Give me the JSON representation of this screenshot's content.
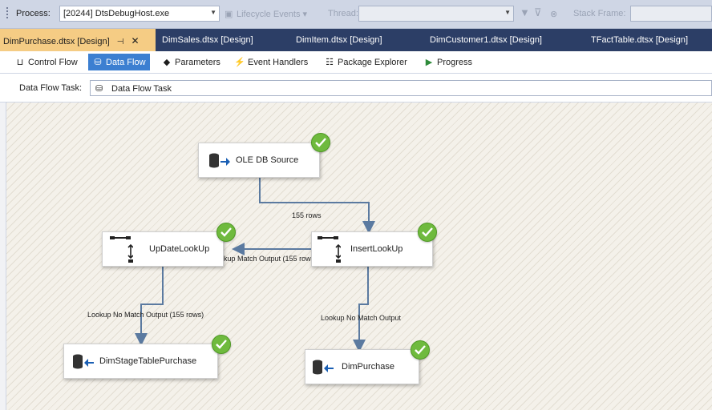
{
  "debug_toolbar": {
    "process_label": "Process:",
    "process_value": "[20244] DtsDebugHost.exe",
    "lifecycle_label": "Lifecycle Events",
    "thread_label": "Thread:",
    "stack_frame_label": "Stack Frame:"
  },
  "document_tabs": [
    {
      "label": "DimPurchase.dtsx [Design]",
      "active": true
    },
    {
      "label": "DimSales.dtsx [Design]"
    },
    {
      "label": "DimItem.dtsx [Design]"
    },
    {
      "label": "DimCustomer1.dtsx [Design]"
    },
    {
      "label": "TFactTable.dtsx [Design]"
    }
  ],
  "designer_tabs": [
    {
      "label": "Control Flow",
      "icon": "control-flow-icon"
    },
    {
      "label": "Data Flow",
      "icon": "data-flow-icon",
      "active": true
    },
    {
      "label": "Parameters",
      "icon": "parameters-icon"
    },
    {
      "label": "Event Handlers",
      "icon": "event-handlers-icon"
    },
    {
      "label": "Package Explorer",
      "icon": "package-explorer-icon"
    },
    {
      "label": "Progress",
      "icon": "progress-icon"
    }
  ],
  "task_bar": {
    "label": "Data Flow Task:",
    "value": "Data Flow Task"
  },
  "components": {
    "ole_db_source": {
      "label": "OLE DB Source",
      "status": "success"
    },
    "update_lookup": {
      "label": "UpDateLookUp",
      "status": "success"
    },
    "insert_lookup": {
      "label": "InsertLookUp",
      "status": "success"
    },
    "dim_stage": {
      "label": "DimStageTablePurchase",
      "status": "success"
    },
    "dim_purchase": {
      "label": "DimPurchase",
      "status": "success"
    }
  },
  "flow_labels": {
    "source_to_insert": "155 rows",
    "match_output": "Lookup Match Output (155 rows)",
    "update_no_match": "Lookup No Match Output (155 rows)",
    "insert_no_match": "Lookup No Match Output"
  },
  "colors": {
    "success": "#6fba3e",
    "flow_line": "#5b7aa0",
    "active_tab": "#f5cc84",
    "tab_strip": "#2c3e66"
  }
}
